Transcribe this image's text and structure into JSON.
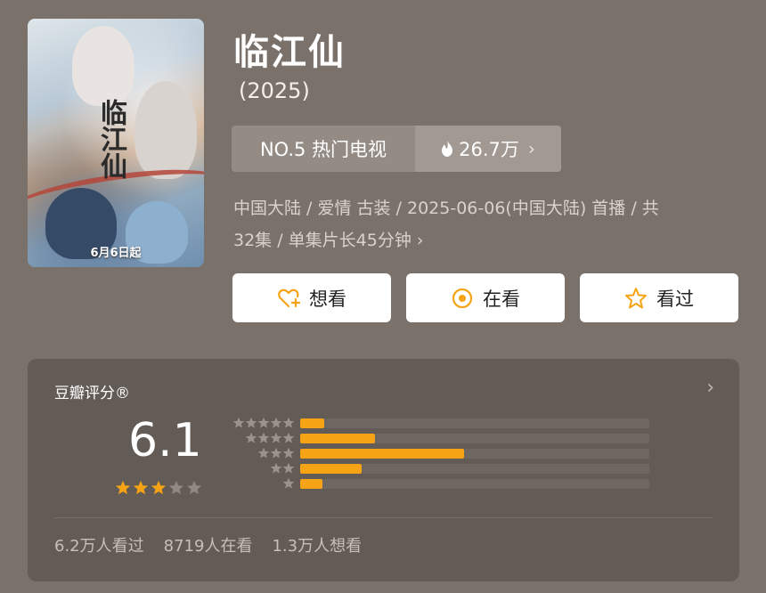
{
  "poster": {
    "release_note": "6月6日起",
    "calligraphy": "临江仙"
  },
  "title": "临江仙",
  "year": "(2025)",
  "rank": {
    "label": "NO.5 热门电视",
    "heat": "26.7万"
  },
  "meta": {
    "line1": "中国大陆 / 爱情 古装 / 2025-06-06(中国大陆) 首播 / 共",
    "line2": "32集 / 单集片长45分钟"
  },
  "buttons": {
    "want": "想看",
    "watching": "在看",
    "watched": "看过"
  },
  "rating": {
    "header": "豆瓣评分®",
    "score": "6.1",
    "stars_filled": 3,
    "stars_total": 5,
    "distribution": [
      {
        "stars": 5,
        "fraction": 0.07
      },
      {
        "stars": 4,
        "fraction": 0.215
      },
      {
        "stars": 3,
        "fraction": 0.47
      },
      {
        "stars": 2,
        "fraction": 0.175
      },
      {
        "stars": 1,
        "fraction": 0.065
      }
    ],
    "stats": {
      "watched": "6.2万人看过",
      "watching": "8719人在看",
      "want": "1.3万人想看"
    }
  },
  "colors": {
    "accent": "#f6a315",
    "background": "#7a716b",
    "card": "#625b56"
  }
}
